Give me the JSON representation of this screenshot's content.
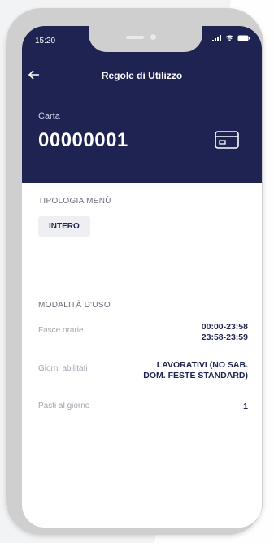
{
  "status_bar": {
    "time": "15:20",
    "signal": "..ıl",
    "wifi": "wifi",
    "battery": "battery"
  },
  "header": {
    "title": "Regole di Utilizzo",
    "back_icon": "back-arrow-icon"
  },
  "card": {
    "label": "Carta",
    "number": "00000001",
    "icon": "card-icon"
  },
  "tipologia": {
    "title": "TIPOLOGIA MENÙ",
    "value": "INTERO"
  },
  "modalita": {
    "title": "MODALITÀ D'USO",
    "rows": [
      {
        "label": "Fasce orarie",
        "value_line1": "00:00-23:58",
        "value_line2": "23:58-23:59"
      },
      {
        "label": "Giorni abilitati",
        "value_line1": "LAVORATIVI (NO SAB.",
        "value_line2": "DOM. FESTE STANDARD)"
      },
      {
        "label": "Pasti al giorno",
        "value_line1": "1",
        "value_line2": ""
      }
    ]
  },
  "colors": {
    "header_bg": "#1f2352",
    "accent": "#1f2352",
    "chip_bg": "#eeeff2"
  }
}
